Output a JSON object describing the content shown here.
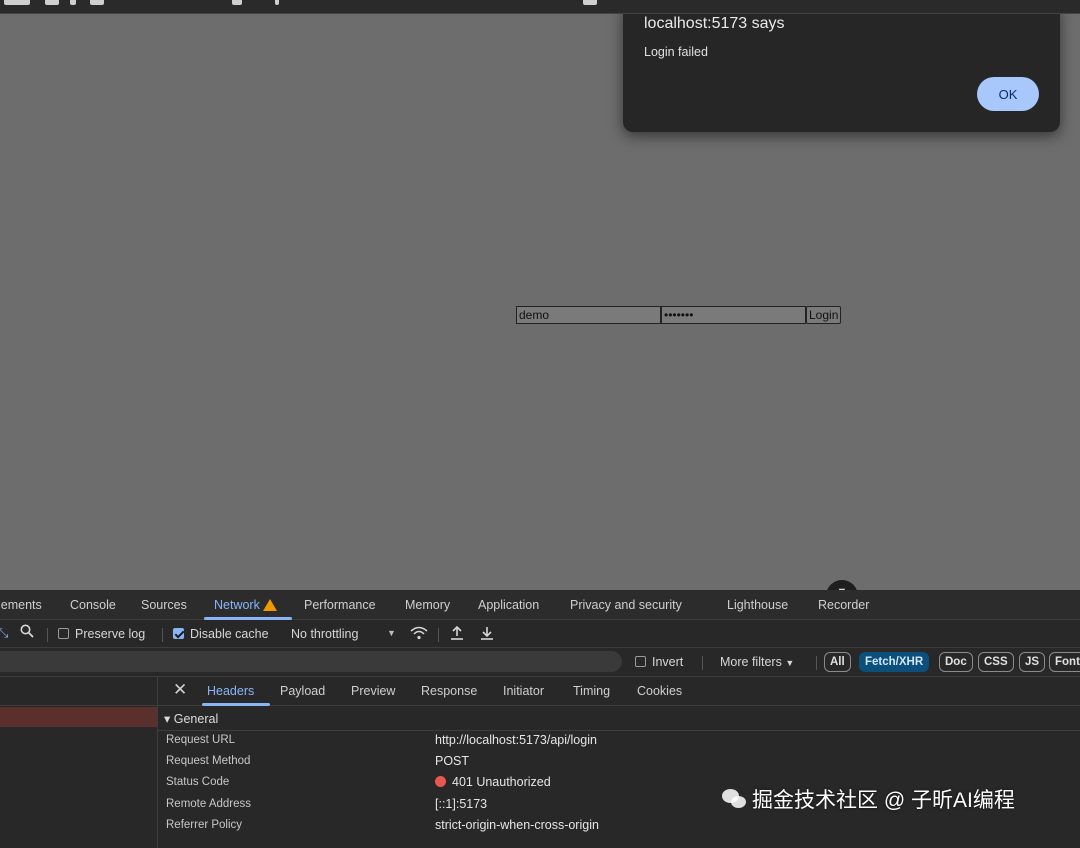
{
  "alert": {
    "title": "localhost:5173 says",
    "message": "Login failed",
    "ok_label": "OK"
  },
  "login": {
    "username_value": "demo",
    "password_value": "•••••••",
    "button_label": "Login"
  },
  "devtools": {
    "tabs": [
      "lements",
      "Console",
      "Sources",
      "Network",
      "Performance",
      "Memory",
      "Application",
      "Privacy and security",
      "Lighthouse",
      "Recorder"
    ],
    "active_tab": "Network",
    "toolbar": {
      "preserve_log": "Preserve log",
      "disable_cache": "Disable cache",
      "throttling": "No throttling"
    },
    "filter": {
      "invert": "Invert",
      "more_filters": "More filters",
      "chips": [
        "All",
        "Fetch/XHR",
        "Doc",
        "CSS",
        "JS",
        "Font"
      ],
      "active_chip": "Fetch/XHR"
    },
    "detail_tabs": [
      "Headers",
      "Payload",
      "Preview",
      "Response",
      "Initiator",
      "Timing",
      "Cookies"
    ],
    "active_detail_tab": "Headers",
    "general_label": "▾ General",
    "general": [
      {
        "key": "Request URL",
        "value": "http://localhost:5173/api/login"
      },
      {
        "key": "Request Method",
        "value": "POST"
      },
      {
        "key": "Status Code",
        "value": "401 Unauthorized"
      },
      {
        "key": "Remote Address",
        "value": "[::1]:5173"
      },
      {
        "key": "Referrer Policy",
        "value": "strict-origin-when-cross-origin"
      }
    ]
  },
  "watermark": "掘金技术社区 @ 子昕AI编程"
}
